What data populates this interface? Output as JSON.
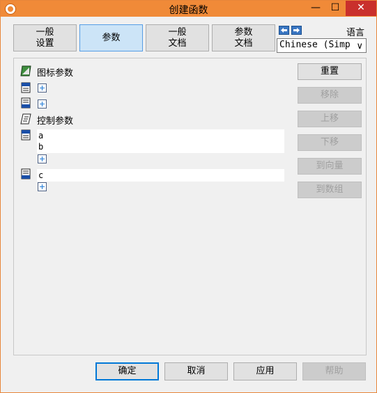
{
  "window": {
    "title": "创建函数",
    "minimize": "—",
    "maximize": "☐",
    "close": "✕"
  },
  "tabs": [
    {
      "label": "一般\n设置"
    },
    {
      "label": "参数"
    },
    {
      "label": "一般\n文档"
    },
    {
      "label": "参数\n文档"
    }
  ],
  "language": {
    "label": "语言",
    "selected": "Chinese (Simp",
    "chevron": "∨"
  },
  "params": {
    "icon_section_label": "图标参数",
    "control_section_label": "控制参数",
    "input_items": [
      "a",
      "b"
    ],
    "output_items": [
      "c"
    ]
  },
  "side_buttons": {
    "reset": "重置",
    "remove": "移除",
    "move_up": "上移",
    "move_down": "下移",
    "to_vector": "到向量",
    "to_array": "到数组"
  },
  "bottom_buttons": {
    "ok": "确定",
    "cancel": "取消",
    "apply": "应用",
    "help": "帮助"
  },
  "colors": {
    "titlebar": "#f08a38",
    "active_tab": "#cce4f7",
    "accent": "#0078d7"
  }
}
